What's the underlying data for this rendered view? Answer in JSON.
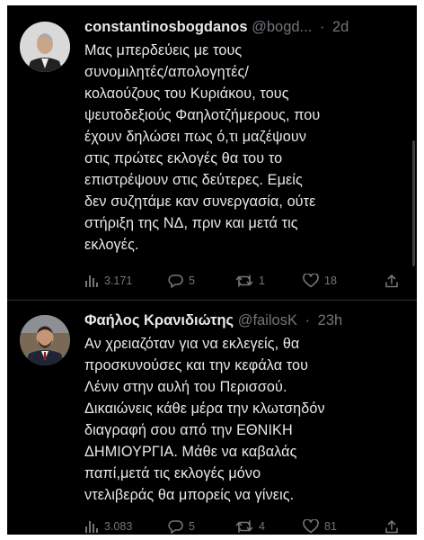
{
  "tweets": [
    {
      "display_name": "constantinosbogdanos",
      "handle": "@bogd...",
      "time": "2d",
      "text_lines": [
        "Μας μπερδεύεις με τους",
        "συνομιλητές/απολογητές/",
        "κολαούζους του Κυριάκου, τους",
        "ψευτοδεξιούς Φαηλοτζήμερους, που",
        "έχουν δηλώσει πως ό,τι μαζέψουν",
        "στις πρώτες εκλογές θα του το",
        "επιστρέψουν στις δεύτερες. Εμείς",
        "δεν συζητάμε καν συνεργασία, ούτε",
        "στήριξη της ΝΔ, πριν και μετά τις",
        "εκλογές."
      ],
      "views": "3.171",
      "replies": "5",
      "retweets": "1",
      "likes": "18"
    },
    {
      "display_name": "Φαήλος Κρανιδιώτης",
      "handle": "@failosK",
      "time": "23h",
      "text_lines": [
        "Αν χρειαζόταν για να εκλεγείς, θα",
        "προσκυνούσες και την κεφάλα του",
        "Λένιν στην αυλή του Περισσού.",
        "Δικαιώνεις κάθε μέρα την κλωτσηδόν",
        "διαγραφή σου από την ΕΘΝΙΚΗ",
        "ΔΗΜΙΟΥΡΓΙΑ. Μάθε να καβαλάς",
        "παπί,μετά τις εκλογές μόνο",
        "ντελιβεράς θα μπορείς να γίνεις."
      ],
      "views": "3.083",
      "replies": "5",
      "retweets": "4",
      "likes": "81"
    }
  ],
  "icons": {
    "views": "views-bar-icon",
    "reply": "reply-bubble-icon",
    "retweet": "retweet-icon",
    "like": "heart-icon",
    "share": "share-upload-icon"
  },
  "colors": {
    "background": "#000000",
    "primary_text": "#e7e9ea",
    "secondary_text": "#71767b",
    "divider": "#2f3336"
  }
}
